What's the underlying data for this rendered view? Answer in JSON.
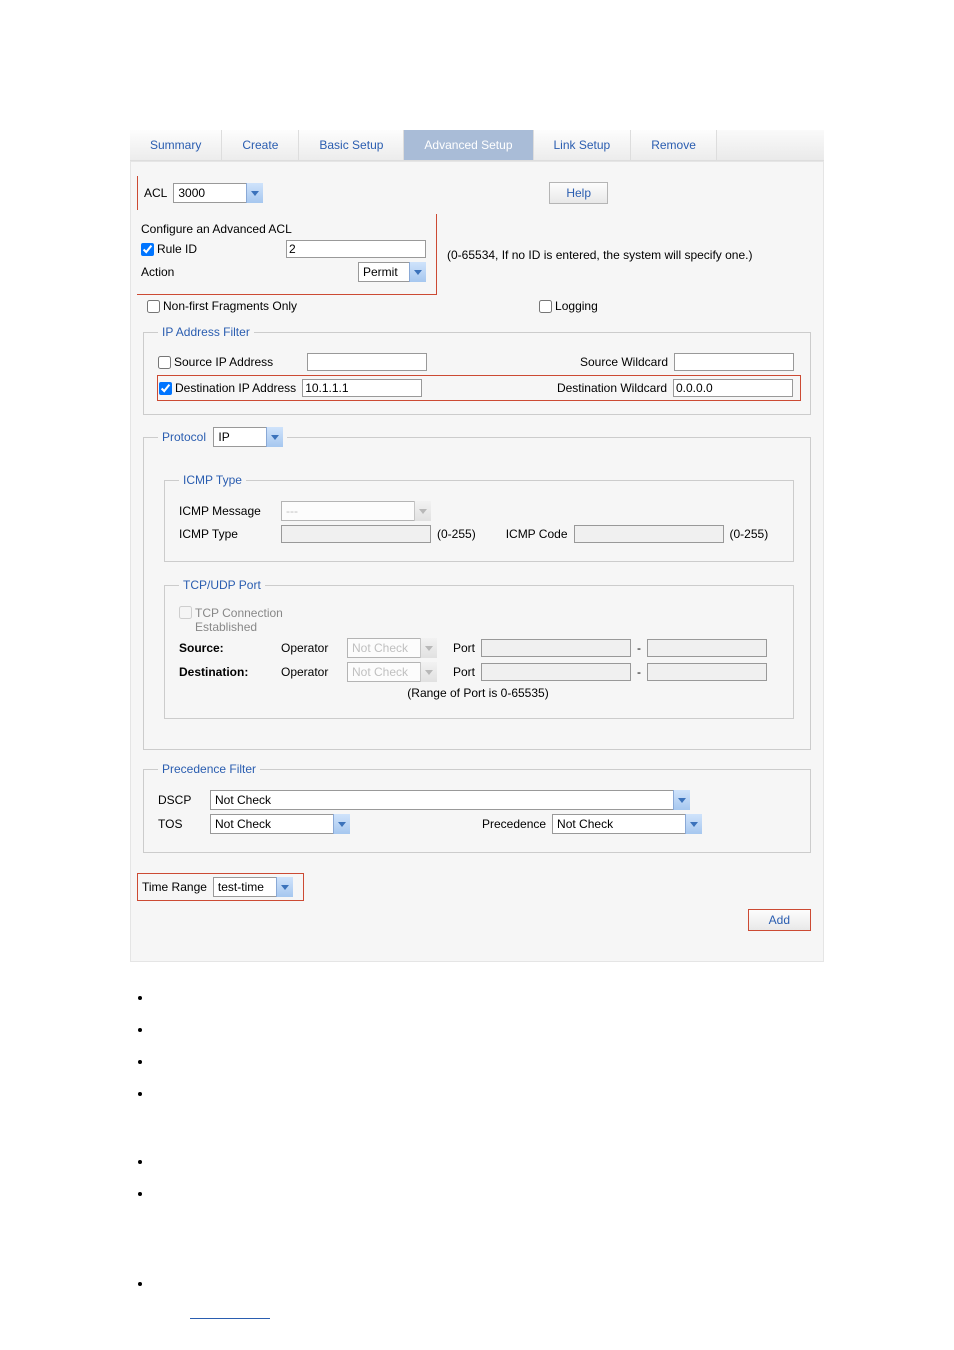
{
  "tabs": {
    "summary": "Summary",
    "create": "Create",
    "basic": "Basic Setup",
    "advanced": "Advanced Setup",
    "link": "Link Setup",
    "remove": "Remove"
  },
  "aclRow": {
    "label": "ACL",
    "value": "3000",
    "help": "Help"
  },
  "configure": {
    "title": "Configure an Advanced ACL",
    "ruleIdLabel": "Rule ID",
    "ruleIdChecked": true,
    "ruleIdValue": "2",
    "ruleIdHint": "(0-65534, If no ID is entered, the system will specify one.)",
    "actionLabel": "Action",
    "actionValue": "Permit",
    "nonFirstLabel": "Non-first Fragments Only",
    "nonFirstChecked": false,
    "loggingLabel": "Logging",
    "loggingChecked": false
  },
  "ipFilter": {
    "legend": "IP Address Filter",
    "srcLabel": "Source IP Address",
    "srcChecked": false,
    "srcValue": "",
    "srcWildLabel": "Source Wildcard",
    "srcWildValue": "",
    "dstLabel": "Destination IP Address",
    "dstChecked": true,
    "dstValue": "10.1.1.1",
    "dstWildLabel": "Destination Wildcard",
    "dstWildValue": "0.0.0.0"
  },
  "protocol": {
    "legend": "Protocol",
    "value": "IP",
    "icmp": {
      "legend": "ICMP Type",
      "msgLabel": "ICMP Message",
      "msgValue": "---",
      "typeLabel": "ICMP Type",
      "typeValue": "",
      "typeHint": "(0-255)",
      "codeLabel": "ICMP Code",
      "codeValue": "",
      "codeHint": "(0-255)"
    },
    "tcp": {
      "legend": "TCP/UDP Port",
      "connLabel": "TCP Connection Established",
      "connChecked": false,
      "sourceLabel": "Source:",
      "destLabel": "Destination:",
      "opLabel": "Operator",
      "opValue": "Not Check",
      "portLabel": "Port",
      "rangeHint": "(Range of Port is 0-65535)",
      "dash": "-"
    }
  },
  "precedence": {
    "legend": "Precedence Filter",
    "dscpLabel": "DSCP",
    "dscpValue": "Not Check",
    "tosLabel": "TOS",
    "tosValue": "Not Check",
    "precLabel": "Precedence",
    "precValue": "Not Check"
  },
  "timeRange": {
    "label": "Time Range",
    "value": "test-time"
  },
  "addLabel": "Add"
}
